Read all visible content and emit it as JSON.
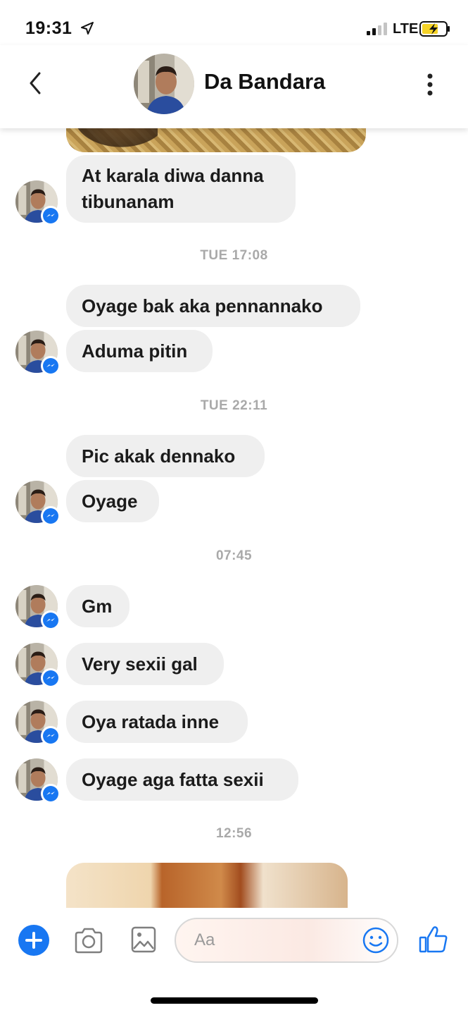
{
  "status_bar": {
    "time": "19:31",
    "network": "LTE",
    "icons": [
      "location-arrow-icon",
      "signal-icon",
      "battery-charging-icon"
    ]
  },
  "header": {
    "contact_name": "Da Bandara",
    "icons": [
      "back-chevron-icon",
      "more-vertical-icon"
    ]
  },
  "messages": [
    {
      "type": "text",
      "text": "At karala diwa danna tibunanam"
    },
    {
      "type": "timestamp",
      "text": "TUE 17:08"
    },
    {
      "type": "text",
      "text": "Oyage bak aka pennannako"
    },
    {
      "type": "text",
      "text": "Aduma pitin"
    },
    {
      "type": "timestamp",
      "text": "TUE 22:11"
    },
    {
      "type": "text",
      "text": "Pic akak dennako"
    },
    {
      "type": "text",
      "text": "Oyage"
    },
    {
      "type": "timestamp",
      "text": "07:45"
    },
    {
      "type": "text",
      "text": "Gm"
    },
    {
      "type": "text",
      "text": "Very sexii gal"
    },
    {
      "type": "text",
      "text": "Oya ratada inne"
    },
    {
      "type": "text",
      "text": "Oyage aga fatta sexii"
    },
    {
      "type": "timestamp",
      "text": "12:56"
    }
  ],
  "composer": {
    "placeholder": "Aa",
    "icons": [
      "plus-icon",
      "camera-icon",
      "gallery-icon",
      "emoji-icon",
      "thumbs-up-icon"
    ]
  },
  "colors": {
    "accent": "#1877f2",
    "bubble": "#efefef",
    "timestamp": "#a9a9a9"
  }
}
